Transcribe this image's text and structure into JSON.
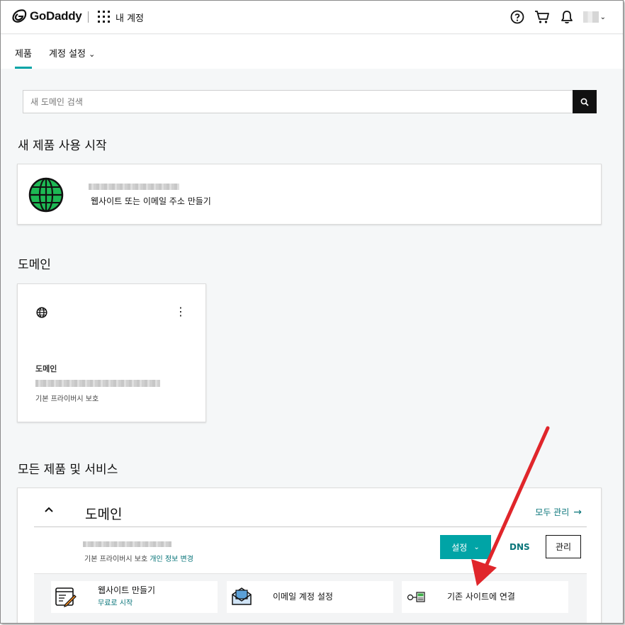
{
  "header": {
    "logo_text": "GoDaddy",
    "account_label": "내 계정",
    "icons": [
      "help-icon",
      "cart-icon",
      "bell-icon",
      "avatar"
    ]
  },
  "subnav": {
    "tab_products": "제품",
    "tab_settings": "계정 설정"
  },
  "search": {
    "placeholder": "새 도메인 검색"
  },
  "sections": {
    "start_title": "새 제품 사용 시작",
    "domains_title": "도메인",
    "all_title": "모든 제품 및 서비스"
  },
  "start_card": {
    "subtitle": "웹사이트 또는 이메일 주소 만들기"
  },
  "domain_card": {
    "label": "도메인",
    "privacy": "기본 프라이버시 보호"
  },
  "all_products": {
    "group_title": "도메인",
    "manage_all": "모두 관리",
    "row_sub_prefix": "기본 프라이버시 보호",
    "row_sub_link": "개인 정보 변경",
    "setup_button": "설정",
    "dns_button": "DNS",
    "manage_button": "관리",
    "tiles": [
      {
        "label": "웹사이트 만들기",
        "link": "무료로 시작"
      },
      {
        "label": "이메일 계정 설정"
      },
      {
        "label": "기존 사이트에 연결"
      }
    ]
  },
  "colors": {
    "accent": "#00a4a6",
    "link": "#09757a",
    "globe_green": "#1db954",
    "annotation_red": "#e0262b"
  }
}
